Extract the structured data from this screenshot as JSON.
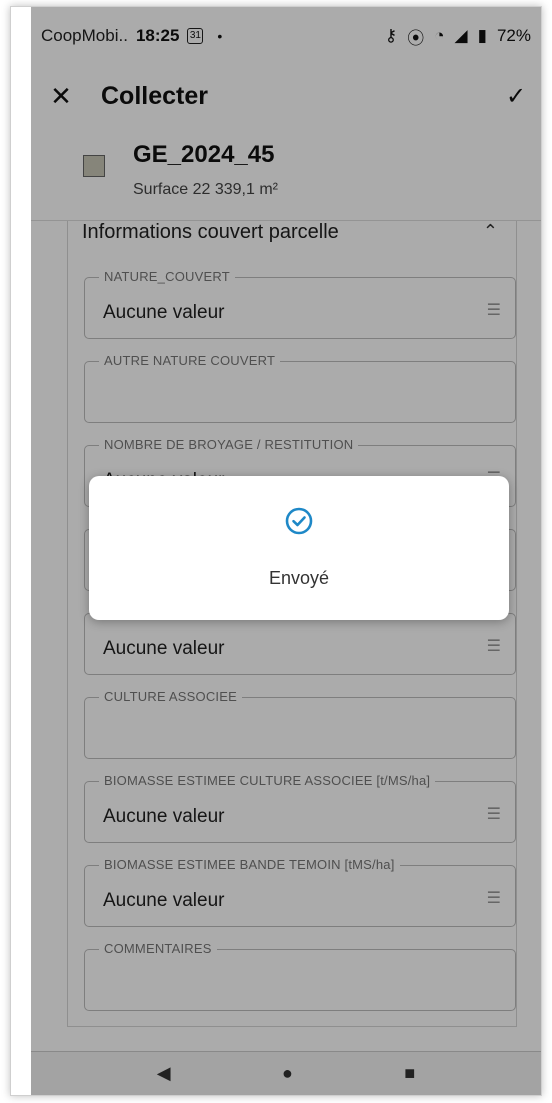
{
  "status_bar": {
    "app_name": "CoopMobi..",
    "time": "18:25",
    "calendar_day": "31",
    "battery": "72%"
  },
  "app_bar": {
    "title": "Collecter"
  },
  "feature": {
    "name": "GE_2024_45",
    "surface": "Surface 22 339,1 m²",
    "swatch_color": "#c8c6b6"
  },
  "section": {
    "title": "Informations couvert parcelle"
  },
  "fields": [
    {
      "label": "NATURE_COUVERT",
      "value": "Aucune valeur"
    },
    {
      "label": "AUTRE NATURE COUVERT",
      "value": ""
    },
    {
      "label": "NOMBRE DE BROYAGE / RESTITUTION",
      "value": "Aucune valeur"
    },
    {
      "label": "",
      "value": ""
    },
    {
      "label": "",
      "value": "Aucune valeur"
    },
    {
      "label": "CULTURE ASSOCIEE",
      "value": ""
    },
    {
      "label": "BIOMASSE ESTIMEE CULTURE ASSOCIEE [t/MS/ha]",
      "value": "Aucune valeur"
    },
    {
      "label": "BIOMASSE ESTIMEE BANDE TEMOIN [tMS/ha]",
      "value": "Aucune valeur"
    },
    {
      "label": "COMMENTAIRES",
      "value": ""
    }
  ],
  "dialog": {
    "message": "Envoyé",
    "icon": "check-circle-icon",
    "accent_color": "#1e88c7"
  }
}
